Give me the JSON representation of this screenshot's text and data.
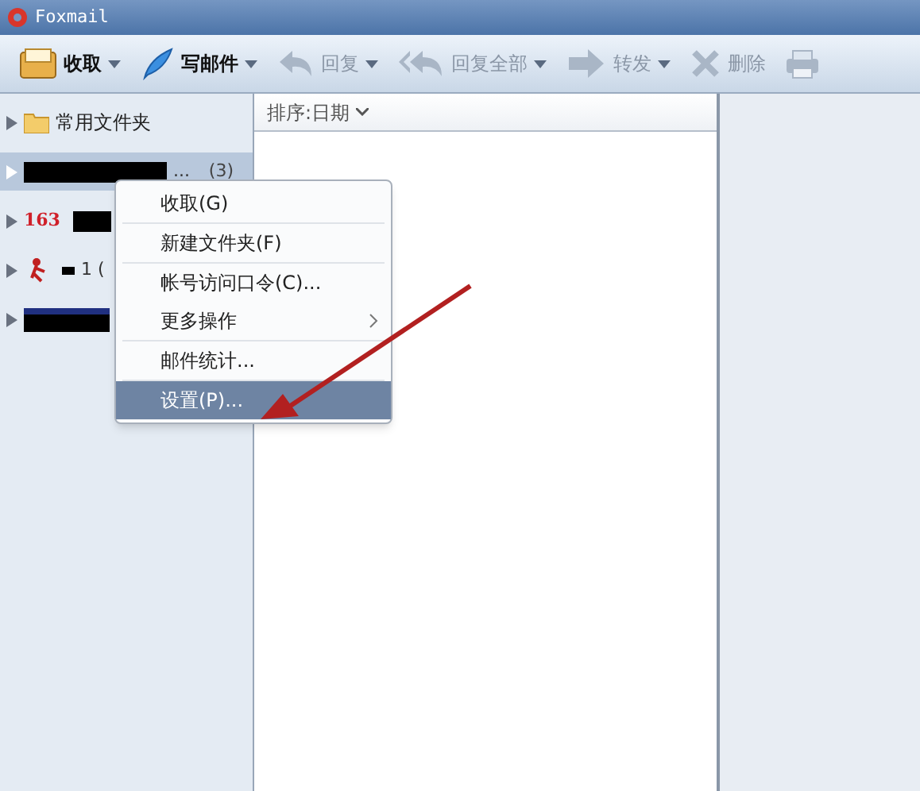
{
  "window": {
    "title": "Foxmail"
  },
  "toolbar": [
    {
      "label": "收取",
      "kind": "receive",
      "disabled": false,
      "dropdown": true
    },
    {
      "label": "写邮件",
      "kind": "compose",
      "disabled": false,
      "dropdown": true
    },
    {
      "label": "回复",
      "kind": "reply",
      "disabled": true,
      "dropdown": true
    },
    {
      "label": "回复全部",
      "kind": "replyall",
      "disabled": true,
      "dropdown": true
    },
    {
      "label": "转发",
      "kind": "forward",
      "disabled": true,
      "dropdown": true
    },
    {
      "label": "删除",
      "kind": "delete",
      "disabled": true,
      "dropdown": false
    },
    {
      "kind": "print",
      "disabled": true,
      "dropdown": false
    }
  ],
  "sidebar": {
    "items": [
      {
        "kind": "folder",
        "label": "常用文件夹",
        "selected": false
      },
      {
        "kind": "account",
        "suffix": "...",
        "count": "(3)",
        "selected": true
      },
      {
        "kind": "logo163",
        "logo": "163",
        "selected": false
      },
      {
        "kind": "figure",
        "suffix": "1 (",
        "selected": false
      },
      {
        "kind": "blue",
        "selected": false
      }
    ]
  },
  "message_list": {
    "sort_label": "排序:日期"
  },
  "context_menu": {
    "items": [
      {
        "label": "收取(G)",
        "selected": false,
        "divider_after": true
      },
      {
        "label": "新建文件夹(F)",
        "selected": false,
        "divider_after": true
      },
      {
        "label": "帐号访问口令(C)...",
        "selected": false,
        "divider_after": false
      },
      {
        "label": "更多操作",
        "selected": false,
        "divider_after": true,
        "submenu": true
      },
      {
        "label": "邮件统计...",
        "selected": false,
        "divider_after": true
      },
      {
        "label": "设置(P)...",
        "selected": true,
        "divider_after": false
      }
    ]
  }
}
